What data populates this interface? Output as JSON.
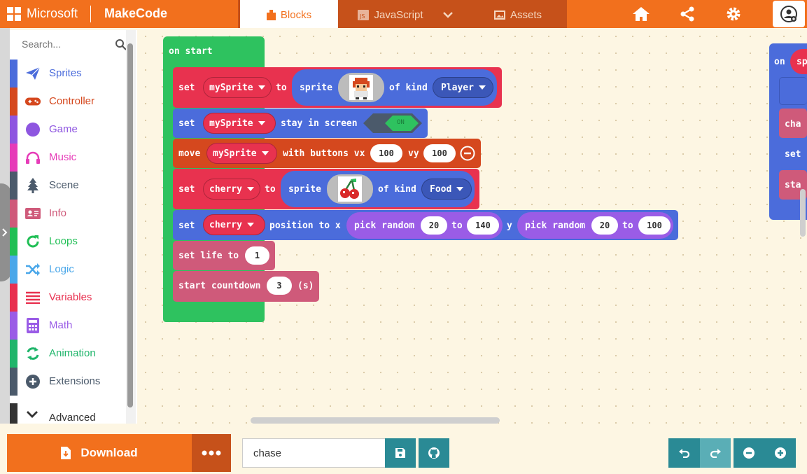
{
  "header": {
    "brand_microsoft": "Microsoft",
    "brand_makecode": "MakeCode",
    "tabs": [
      {
        "label": "Blocks",
        "icon": "blocks-icon",
        "active": true
      },
      {
        "label": "JavaScript",
        "icon": "javascript-icon",
        "active": false
      },
      {
        "label": "Assets",
        "icon": "image-icon",
        "active": false
      }
    ],
    "icons": [
      "home-icon",
      "share-icon",
      "gear-icon",
      "user-icon"
    ],
    "colors": {
      "brand": "#f2701d",
      "tabbar": "#c6511a"
    }
  },
  "search": {
    "placeholder": "Search..."
  },
  "toolbox": {
    "categories": [
      {
        "label": "Sprites",
        "color": "#4b6cdb",
        "icon": "paper-plane-icon"
      },
      {
        "label": "Controller",
        "color": "#d5481e",
        "icon": "gamepad-icon"
      },
      {
        "label": "Game",
        "color": "#8e56e0",
        "icon": "circle-icon"
      },
      {
        "label": "Music",
        "color": "#e63cb8",
        "icon": "headphones-icon"
      },
      {
        "label": "Scene",
        "color": "#4b5a6b",
        "icon": "tree-icon"
      },
      {
        "label": "Info",
        "color": "#cf5a7a",
        "icon": "id-card-icon"
      },
      {
        "label": "Loops",
        "color": "#20bf55",
        "icon": "refresh-icon"
      },
      {
        "label": "Logic",
        "color": "#4aa7e9",
        "icon": "shuffle-icon"
      },
      {
        "label": "Variables",
        "color": "#e8304f",
        "icon": "list-icon"
      },
      {
        "label": "Math",
        "color": "#9a5ce6",
        "icon": "calculator-icon"
      },
      {
        "label": "Animation",
        "color": "#20b56b",
        "icon": "recycle-icon"
      },
      {
        "label": "Extensions",
        "color": "#4b5a6b",
        "icon": "plus-circle-icon"
      }
    ],
    "advanced": "Advanced"
  },
  "workspace": {
    "on_start": "on start",
    "set": "set",
    "to": "to",
    "of_kind": "of kind",
    "sprite": "sprite",
    "blocks": {
      "set_player": {
        "var": "mySprite",
        "kind": "Player"
      },
      "stay": {
        "var": "mySprite",
        "text": "stay in screen",
        "toggle": "ON"
      },
      "move": {
        "label": "move",
        "var": "mySprite",
        "text": "with buttons vx",
        "vx": "100",
        "vy_label": "vy",
        "vy": "100"
      },
      "set_cherry": {
        "var": "cherry",
        "kind": "Food"
      },
      "position": {
        "var": "cherry",
        "text": "position to x",
        "pick": "pick random",
        "x_from": "20",
        "x_to": "140",
        "y_label": "y",
        "y_from": "20",
        "y_to": "100"
      },
      "life": {
        "text": "set life to",
        "value": "1"
      },
      "countdown": {
        "text": "start countdown",
        "value": "3",
        "unit": "(s)"
      }
    },
    "peek": {
      "on": "on",
      "sp": "spr",
      "cha": "cha",
      "set": "set",
      "sta": "sta"
    }
  },
  "bottom": {
    "download": "Download",
    "project_name": "chase"
  }
}
